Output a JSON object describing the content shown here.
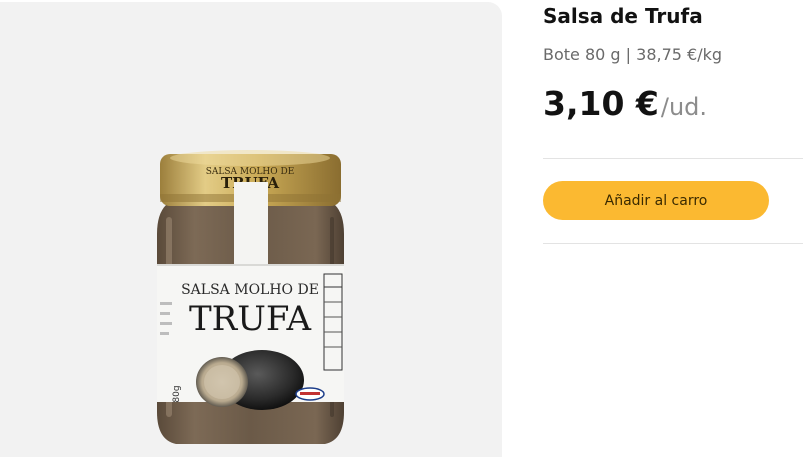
{
  "product": {
    "name": "Salsa de Trufa",
    "details": "Bote 80 g | 38,75 €/kg",
    "price": "3,10 €",
    "unit": "/ud.",
    "add_to_cart_label": "Añadir al carro"
  },
  "jar_label": {
    "lid_text": "SALSA MOLHO DE TRUFA",
    "line1": "SALSA MOLHO DE",
    "line2": "TRUFA",
    "weight": "80g"
  },
  "colors": {
    "accent": "#fbb931",
    "panel_bg": "#f2f2f2",
    "lid_gold": "#c9a955",
    "sauce_brown": "#6b5a48"
  }
}
